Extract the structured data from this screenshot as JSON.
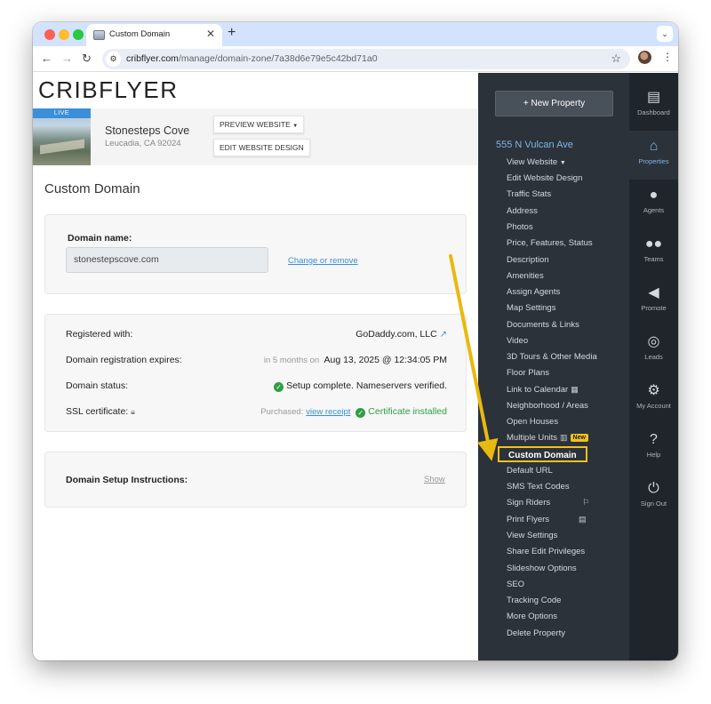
{
  "browser": {
    "tab_title": "Custom Domain",
    "url_host": "cribflyer.com",
    "url_path": "/manage/domain-zone/7a38d6e79e5c42bd71a0"
  },
  "logo": "CRIBFLYER",
  "property": {
    "live_badge": "LIVE",
    "name": "Stonesteps Cove",
    "location": "Leucadia, CA 92024",
    "preview_button": "PREVIEW WEBSITE",
    "edit_design_button": "EDIT WEBSITE DESIGN"
  },
  "page_title": "Custom Domain",
  "domain": {
    "label": "Domain name:",
    "value": "stonestepscove.com",
    "change_link": "Change or remove"
  },
  "details": {
    "registered_label": "Registered with:",
    "registered_value": "GoDaddy.com, LLC",
    "expires_label": "Domain registration expires:",
    "expires_relative": "in 5 months on",
    "expires_value": "Aug 13, 2025 @ 12:34:05 PM",
    "status_label": "Domain status:",
    "status_value": "Setup complete. Nameservers verified.",
    "ssl_label": "SSL certificate:",
    "ssl_purchased": "Purchased:",
    "ssl_receipt_link": "view receipt",
    "ssl_value": "Certificate installed"
  },
  "setup": {
    "label": "Domain Setup Instructions:",
    "show_link": "Show"
  },
  "sidebar": {
    "new_property": "New Property",
    "property_title": "555 N Vulcan Ave",
    "items": [
      "View Website",
      "Edit Website Design",
      "Traffic Stats",
      "Address",
      "Photos",
      "Price, Features, Status",
      "Description",
      "Amenities",
      "Assign Agents",
      "Map Settings",
      "Documents & Links",
      "Video",
      "3D Tours & Other Media",
      "Floor Plans",
      "Link to Calendar",
      "Neighborhood / Areas",
      "Open Houses",
      "Multiple Units",
      "Custom Domain",
      "Default URL",
      "SMS Text Codes",
      "Sign Riders",
      "Print Flyers",
      "View Settings",
      "Share Edit Privileges",
      "Slideshow Options",
      "SEO",
      "Tracking Code",
      "More Options",
      "Delete Property"
    ],
    "new_badge": "New"
  },
  "rail": {
    "items": [
      "Dashboard",
      "Properties",
      "Agents",
      "Teams",
      "Promote",
      "Leads",
      "My Account",
      "Help",
      "Sign Out"
    ]
  },
  "colors": {
    "sidebar_bg": "#2c323a",
    "rail_bg": "#20252b",
    "accent_blue": "#7fb5e6",
    "highlight_yellow": "#f1c21b",
    "success_green": "#2f9e44"
  }
}
